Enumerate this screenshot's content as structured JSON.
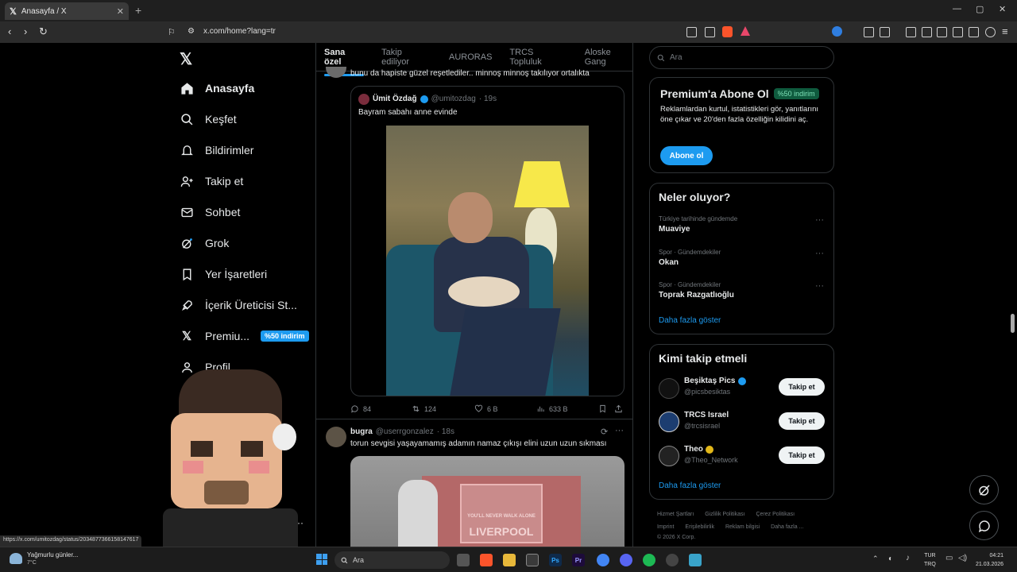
{
  "browser": {
    "tab_title": "Anasayfa / X",
    "tab_logo": "𝕏",
    "tab_close": "✕",
    "new_tab": "+",
    "url": "x.com/home?lang=tr",
    "minimize": "—",
    "maximize": "▢",
    "close": "✕"
  },
  "nav": {
    "logo": "𝕏",
    "items": [
      {
        "label": "Anasayfa",
        "icon": "home-icon"
      },
      {
        "label": "Keşfet",
        "icon": "search-icon"
      },
      {
        "label": "Bildirimler",
        "icon": "bell-icon"
      },
      {
        "label": "Takip et",
        "icon": "follow-icon"
      },
      {
        "label": "Sohbet",
        "icon": "mail-icon"
      },
      {
        "label": "Grok",
        "icon": "grok-icon"
      },
      {
        "label": "Yer İşaretleri",
        "icon": "bookmark-icon"
      },
      {
        "label": "İçerik Üreticisi St...",
        "icon": "rocket-icon"
      },
      {
        "label": "Premiu...",
        "icon": "x-icon"
      },
      {
        "label": "Profil",
        "icon": "profile-icon"
      }
    ],
    "premium_badge": "%50 indirim",
    "more": "···"
  },
  "topics": [
    "Sana özel",
    "Takip ediliyor",
    "AURORAS",
    "TRCS Topluluk",
    "Aloske Gang"
  ],
  "feed": {
    "partial_text": "bunu da hapiste güzel reşetlediler.. minnoş minnoş takılıyor ortalıkta",
    "quote": {
      "name": "Ümit Özdağ",
      "handle": "@umitozdag",
      "time": "· 19s",
      "text": "Bayram sabahı anne evinde"
    },
    "stats": {
      "replies": "84",
      "reposts": "124",
      "likes": "6 B",
      "views": "633 B"
    },
    "post2": {
      "name": "bugra",
      "handle": "@userrgonzalez",
      "time": "· 18s",
      "text": "torun sevgisi yaşayamamış adamın namaz çıkışı elini uzun uzun sıkması",
      "sign_line1": "YOU'LL NEVER WALK ALONE",
      "sign_line2": "LIVERPOOL"
    }
  },
  "right": {
    "search_placeholder": "Ara",
    "premium": {
      "title": "Premium'a Abone Ol",
      "badge": "%50 indirim",
      "body": "Reklamlardan kurtul, istatistikleri gör, yanıtlarını öne çıkar ve 20'den fazla özelliğin kilidini aç.",
      "button": "Abone ol"
    },
    "trends": {
      "title": "Neler oluyor?",
      "items": [
        {
          "category": "Türkiye tarihinde gündemde",
          "name": "Muaviye"
        },
        {
          "category": "Spor · Gündemdekiler",
          "name": "Okan"
        },
        {
          "category": "Spor · Gündemdekiler",
          "name": "Toprak Razgatlıoğlu"
        }
      ],
      "show_more": "Daha fazla göster"
    },
    "who_to_follow": {
      "title": "Kimi takip etmeli",
      "accounts": [
        {
          "name": "Beşiktaş Pics",
          "handle": "@picsbesiktas",
          "button": "Takip et"
        },
        {
          "name": "TRCS Israel",
          "handle": "@trcsisrael",
          "button": "Takip et"
        },
        {
          "name": "Theo",
          "handle": "@Theo_Network",
          "button": "Takip et"
        }
      ],
      "show_more": "Daha fazla göster"
    },
    "footer": {
      "row1": [
        "Hizmet Şartları",
        "Gizlilik Politikası",
        "Çerez Politikası"
      ],
      "row2": [
        "Imprint",
        "Erişilebilirlik",
        "Reklam bilgisi",
        "Daha fazla ..."
      ],
      "copyright": "© 2026 X Corp."
    }
  },
  "status_url": "https://x.com/umitozdag/status/2034877366158147617",
  "taskbar": {
    "weather_title": "Yağmurlu günler...",
    "weather_temp": "7°C",
    "search": "Ara",
    "lang1": "TUR",
    "lang2": "TRQ",
    "time": "04:21",
    "date": "21.03.2026"
  },
  "colors": {
    "accent": "#1d9bf0",
    "background": "#000000",
    "border": "#2f3336"
  }
}
